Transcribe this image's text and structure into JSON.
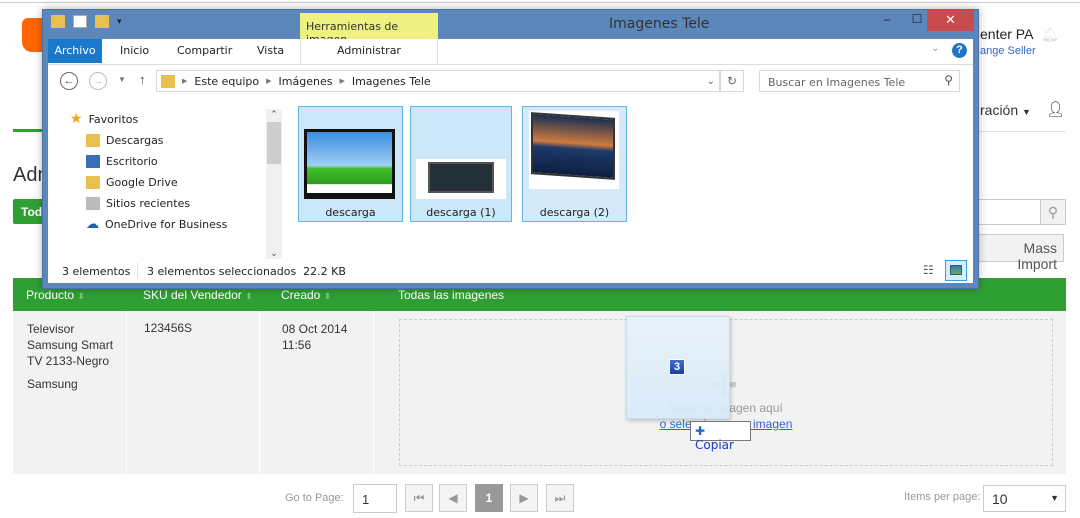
{
  "page": {
    "heading": "Adm",
    "filter_button": "Todo",
    "seller_name": "enter PA",
    "change_seller": "ange Seller",
    "nav_menu": "ración",
    "mass_import": "Mass Import",
    "colors": {
      "green": "#2f9f34",
      "orange": "#ff6600",
      "link": "#3366cc"
    },
    "table": {
      "headers": [
        "Producto",
        "SKU del Vendedor",
        "Creado",
        "Todas las imagenes"
      ],
      "rows": [
        {
          "product": [
            "Televisor",
            "Samsung Smart",
            "TV 2133-Negro"
          ],
          "brand": "Samsung",
          "sku": "123456S",
          "created_date": "08 Oct 2014",
          "created_time": "11:56"
        }
      ],
      "dropzone": {
        "text": "Soltar la imagen aquí",
        "link": "o selecciona una imagen"
      }
    },
    "pagination": {
      "goto_label": "Go to Page:",
      "goto_value": "1",
      "current_page": "1",
      "items_label": "Items per page:",
      "items_value": "10"
    }
  },
  "explorer": {
    "title": "Imagenes Tele",
    "context_tab": "Herramientas de imagen",
    "tabs": [
      "Archivo",
      "Inicio",
      "Compartir",
      "Vista",
      "Administrar"
    ],
    "breadcrumb": [
      "Este equipo",
      "Imágenes",
      "Imagenes Tele"
    ],
    "search_placeholder": "Buscar en Imagenes Tele",
    "favorites_label": "Favoritos",
    "nav_items": [
      "Descargas",
      "Escritorio",
      "Google Drive",
      "Sitios recientes",
      "OneDrive for Business"
    ],
    "files": [
      "descarga",
      "descarga (1)",
      "descarga (2)"
    ],
    "status": {
      "count": "3 elementos",
      "selected": "3 elementos seleccionados",
      "size": "22.2 KB"
    }
  },
  "drag": {
    "count": "3",
    "action": "Copiar"
  }
}
